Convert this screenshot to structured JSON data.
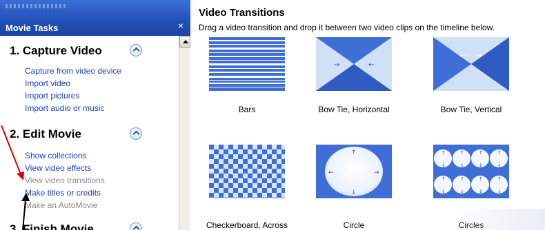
{
  "taskpane": {
    "title": "Movie Tasks",
    "close_glyph": "×",
    "sections": [
      {
        "title": "1. Capture Video",
        "links": [
          {
            "label": "Capture from video device",
            "state": "enabled"
          },
          {
            "label": "Import video",
            "state": "enabled"
          },
          {
            "label": "Import pictures",
            "state": "enabled"
          },
          {
            "label": "Import audio or music",
            "state": "enabled"
          }
        ]
      },
      {
        "title": "2. Edit Movie",
        "links": [
          {
            "label": "Show collections",
            "state": "enabled"
          },
          {
            "label": "View video effects",
            "state": "enabled"
          },
          {
            "label": "View video transitions",
            "state": "disabled"
          },
          {
            "label": "Make titles or credits",
            "state": "enabled"
          },
          {
            "label": "Make an AutoMovie",
            "state": "disabled"
          }
        ]
      },
      {
        "title": "3. Finish Movie",
        "links": []
      }
    ]
  },
  "content": {
    "title": "Video Transitions",
    "subtitle": "Drag a video transition and drop it between two video clips on the timeline below.",
    "transitions": [
      {
        "label": "Bars",
        "icon": "bars-transition-icon"
      },
      {
        "label": "Bow Tie, Horizontal",
        "icon": "bow-tie-horizontal-icon"
      },
      {
        "label": "Bow Tie, Vertical",
        "icon": "bow-tie-vertical-icon"
      },
      {
        "label": "Checkerboard, Across",
        "icon": "checkerboard-across-icon"
      },
      {
        "label": "Circle",
        "icon": "circle-transition-icon"
      },
      {
        "label": "Circles",
        "icon": "circles-transition-icon"
      }
    ]
  },
  "colors": {
    "header_blue": "#2452b8",
    "link_blue": "#1a3fbf",
    "disabled_gray": "#8a8a8a",
    "thumb_blue": "#3f6fd6",
    "annotation_red": "#e00000",
    "annotation_black": "#000000"
  }
}
